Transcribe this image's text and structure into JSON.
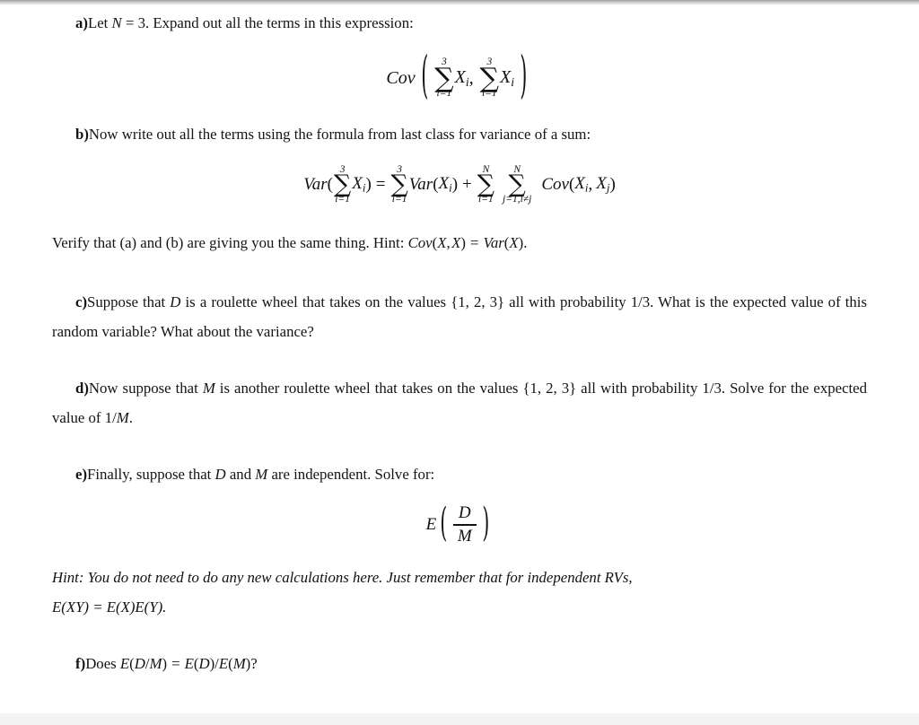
{
  "document": {
    "type": "math-homework-worksheet",
    "parts": [
      {
        "id": "a",
        "label": "a)",
        "text": "Let N = 3. Expand out all the terms in this expression:",
        "text_pre": "Let ",
        "var_N": "N",
        "eq": " = 3. Expand out all the terms in this expression:"
      },
      {
        "id": "b",
        "label": "b)",
        "text": "Now write out all the terms using the formula from last class for variance of a sum:"
      },
      {
        "id": "verify",
        "text_pre": "Verify that (a) and (b) are giving you the same thing. Hint: ",
        "formula": "Cov(X, X) = Var(X)."
      },
      {
        "id": "c",
        "label": "c)",
        "line1": "Suppose that D is a roulette wheel that takes on the values {1, 2, 3} all with probability 1/3.",
        "line2": "What is the expected value of this random variable? What about the variance?"
      },
      {
        "id": "d",
        "label": "d)",
        "line1": "Now suppose that M is another roulette wheel that takes on the values {1, 2, 3} all with",
        "line2": "probability 1/3. Solve for the expected value of 1/M."
      },
      {
        "id": "e",
        "label": "e)",
        "text": "Finally, suppose that D and M are independent. Solve for:"
      },
      {
        "id": "hint",
        "line1": "Hint: You do not need to do any new calculations here. Just remember that for independent RVs,",
        "line2": "E(XY) = E(X)E(Y)."
      },
      {
        "id": "f",
        "label": "f)",
        "text": "Does E(D/M) = E(D)/E(M)?"
      }
    ],
    "text": {
      "part_a_pre": "Let ",
      "part_a_post": " = 3. Expand out all the terms in this expression:",
      "part_b": "Now write out all the terms using the formula from last class for variance of a sum:",
      "verify_pre": "Verify that (a) and (b) are giving you the same thing. Hint: ",
      "part_c_pre": "Suppose that ",
      "part_c_mid": " is a roulette wheel that takes on the values ",
      "part_c_set": "{1, 2, 3}",
      "part_c_post": " all with probability 1/3. What is the expected value of this random variable? What about the variance?",
      "part_d_pre": "Now suppose that ",
      "part_d_mid": " is another roulette wheel that takes on the values ",
      "part_d_set": "{1, 2, 3}",
      "part_d_post": " all with probability 1/3. Solve for the expected value of 1/",
      "part_d_end": ".",
      "part_e_pre": "Finally, suppose that ",
      "part_e_and": " and ",
      "part_e_post": " are independent. Solve for:",
      "hint_line1": "Hint: You do not need to do any new calculations here. Just remember that for independent RVs,",
      "part_f_pre": "Does "
    },
    "symbols": {
      "N": "N",
      "D": "D",
      "M": "M",
      "X": "X",
      "Y": "Y",
      "i": "i",
      "j": "j",
      "three": "3",
      "one": "1",
      "X_i": "X",
      "X_j": "X",
      "sum_glyph": "∑",
      "paren_open": "(",
      "paren_close": ")",
      "comma": ",",
      "equals": "=",
      "plus": "+",
      "neq": "≠",
      "Cov": "Cov",
      "Var": "Var",
      "E": "E",
      "slash": "/",
      "question": "?",
      "period": ".",
      "sub_i_eq_1": "i=1",
      "sub_j_eq_1_i_neq_j": "j=1,i≠j"
    },
    "formulas": {
      "a_display": "Cov( ∑_{i=1}^{3} X_i , ∑_{i=1}^{3} X_i )",
      "b_display": "Var( ∑_{i=1}^{3} X_i ) = ∑_{i=1}^{3} Var(X_i) + ∑_{i=1}^{N} ∑_{j=1,i≠j}^{N} Cov(X_i, X_j)",
      "verify_hint": "Cov(X,X) = Var(X).",
      "e_display": "E( D / M )",
      "hint_line2": "E(XY) = E(X)E(Y).",
      "f_question": "E(D/M) = E(D)/E(M)?"
    },
    "colors": {
      "page_background": "#ffffff",
      "text": "#141414",
      "top_edge_shadow": "#9a9a9a",
      "bottom_band": "#f4f4f4"
    }
  }
}
